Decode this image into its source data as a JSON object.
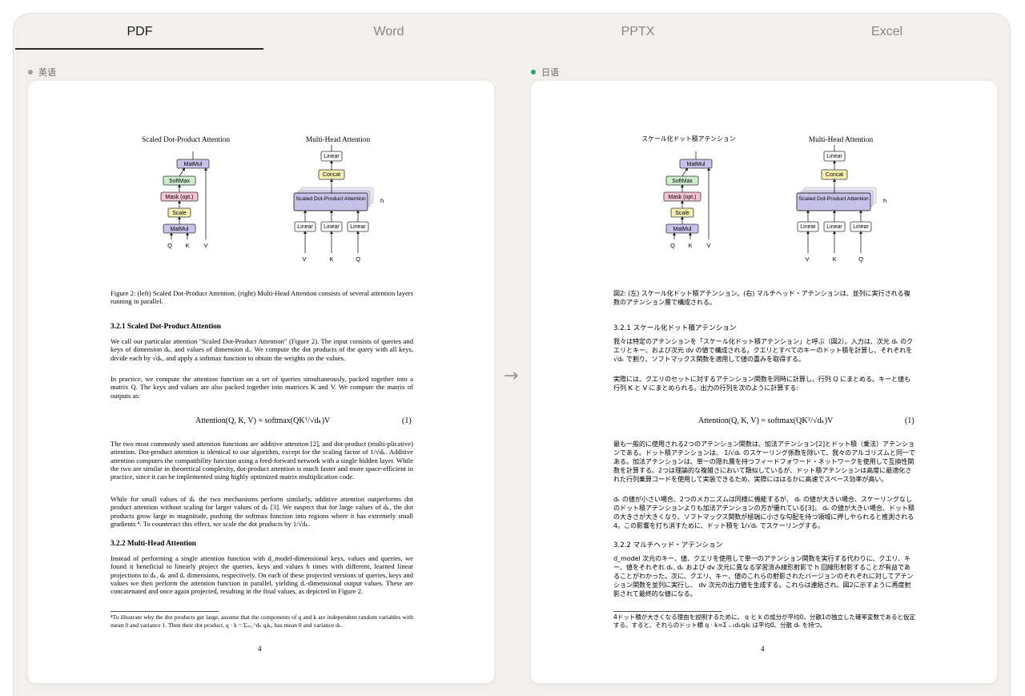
{
  "tabs": [
    {
      "label": "PDF",
      "active": true
    },
    {
      "label": "Word",
      "active": false
    },
    {
      "label": "PPTX",
      "active": false
    },
    {
      "label": "Excel",
      "active": false
    }
  ],
  "colors": {
    "accent": "#2a2a2a",
    "source_dot": "#a3a09b",
    "target_dot": "#2b9e83",
    "frame_bg": "#f2f0ec"
  },
  "source": {
    "label": "英语",
    "diagram": {
      "left_title": "Scaled Dot-Product Attention",
      "right_title": "Multi-Head Attention",
      "left_blocks": [
        "MatMul",
        "SoftMax",
        "Mask (opt.)",
        "Scale",
        "MatMul"
      ],
      "left_inputs": [
        "Q",
        "K",
        "V"
      ],
      "right_blocks": [
        "Linear",
        "Concat",
        "Scaled Dot-Product Attention",
        "Linear",
        "Linear",
        "Linear"
      ],
      "right_inputs": [
        "V",
        "K",
        "Q"
      ],
      "h_label": "h"
    },
    "caption": "Figure 2: (left) Scaled Dot-Product Attention. (right) Multi-Head Attention consists of several attention layers running in parallel.",
    "sec1_title": "3.2.1    Scaled Dot-Product Attention",
    "p1": "We call our particular attention \"Scaled Dot-Product Attention\" (Figure 2). The input consists of queries and keys of dimension dₖ, and values of dimension dᵥ. We compute the dot products of the query with all keys, divide each by √dₖ, and apply a softmax function to obtain the weights on the values.",
    "p2": "In practice, we compute the attention function on a set of queries simultaneously, packed together into a matrix Q. The keys and values are also packed together into matrices K and V. We compute the matrix of outputs as:",
    "equation": "Attention(Q, K, V) = softmax(QKᵀ/√dₖ)V",
    "equation_number": "(1)",
    "p3": "The two most commonly used attention functions are additive attention [2], and dot-product (multi-plicative) attention. Dot-product attention is identical to our algorithm, except for the scaling factor of 1/√dₖ. Additive attention computes the compatibility function using a feed-forward network with a single hidden layer. While the two are similar in theoretical complexity, dot-product attention is much faster and more space-efficient in practice, since it can be implemented using highly optimized matrix multiplication code.",
    "p4": "While for small values of dₖ the two mechanisms perform similarly, additive attention outperforms dot product attention without scaling for larger values of dₖ [3]. We suspect that for large values of dₖ, the dot products grow large in magnitude, pushing the softmax function into regions where it has extremely small gradients ⁴. To counteract this effect, we scale the dot products by 1/√dₖ.",
    "sec2_title": "3.2.2    Multi-Head Attention",
    "p5": "Instead of performing a single attention function with d_model-dimensional keys, values and queries, we found it beneficial to linearly project the queries, keys and values h times with different, learned linear projections to dₖ, dₖ and dᵥ dimensions, respectively. On each of these projected versions of queries, keys and values we then perform the attention function in parallel, yielding dᵥ-dimensional output values. These are concatenated and once again projected, resulting in the final values, as depicted in Figure 2.",
    "footnote": "⁴To illustrate why the dot products get large, assume that the components of q and k are independent random variables with mean 0 and variance 1. Then their dot product, q · k = Σᵢ₌₁^dₖ qᵢkᵢ, has mean 0 and variance dₖ.",
    "page_number": "4"
  },
  "arrow": "→",
  "target": {
    "label": "日语",
    "diagram": {
      "left_title": "スケール化ドット積アテンション",
      "right_title": "Multi-Head Attention",
      "left_blocks": [
        "MatMul",
        "SoftMax",
        "Mask (opt.)",
        "Scale",
        "MatMul"
      ],
      "left_inputs": [
        "Q",
        "K",
        "V"
      ],
      "right_blocks": [
        "Linear",
        "Concat",
        "Scaled Dot-Product Attention",
        "Linear",
        "Linear",
        "Linear"
      ],
      "right_inputs": [
        "V",
        "K",
        "Q"
      ],
      "h_label": "h"
    },
    "caption": "図2: (左) スケール化ドット積アテンション。(右) マルチヘッド・アテンションは、並列に実行される複数のアテンション層で構成される。",
    "sec1_title": "3.2.1 スケール化ドット積アテンション",
    "p1": "我々は特定のアテンションを「スケール化ドット積アテンション」と呼ぶ（図2）。入力は、次元 dₖ のクエリとキー、および次元 dv の値で構成される。クエリとすべてのキーのドット積を計算し、それぞれを √dₖ で割り、ソフトマックス関数を適用して値の重みを取得する。",
    "p2": "実際には、クエリのセットに対するアテンション関数を同時に計算し、行列 Q にまとめる。キーと値も行列 K と V にまとめられる。出力の行列を次のように計算する:",
    "equation": "Attention(Q, K, V) = softmax(QKᵀ/√dₖ)V",
    "equation_number": "(1)",
    "p3": "最も一般的に使用される2つのアテンション関数は、加法アテンション[2]とドット積（乗法）アテンションである。ドット積アテンションは、 1/√dₖ のスケーリング係数を除いて、我々のアルゴリズムと同一である。加法アテンションは、単一の隠れ層を持つフィードフォワード・ネットワークを使用して互換性関数を計算する。2つは理論的な複雑さにおいて類似しているが、ドット積アテンションは高度に最適化された行列乗算コードを使用して実装できるため、実際にははるかに高速でスペース効率が高い。",
    "p4": "dₖ の値が小さい場合、2つのメカニズムは同様に機能するが、 dₖ の値が大きい場合、スケーリングなしのドット積アテンションよりも加法アテンションの方が優れている[3]。 dₖ の値が大きい場合、ドット積の大きさが大きくなり、ソフトマックス関数が極端に小さな勾配を持つ領域に押しやられると推測される4。この影響を打ち消すために、ドット積を 1/√dₖ でスケーリングする。",
    "sec2_title": "3.2.2 マルチヘッド・アテンション",
    "p5": "d_model 次元のキー、値、クエリを使用して単一のアテンション関数を実行する代わりに、クエリ、キー、値をそれぞれ dₖ, dₖ および dv 次元に異なる学習済み線形射影で h 回線形射影することが有益であることがわかった。次に、クエリ、キー、値のこれらの射影されたバージョンのそれぞれに対してアテンション関数を並列に実行し、 dv 次元の出力値を生成する。これらは連結され、図2に示すように再度射影されて最終的な値になる。",
    "footnote": "4ドット積が大きくなる理由を説明するために、 q と k の成分が平均0、分散1の独立した確率変数であると仮定する。すると、それらのドット積 q · k=Σ ᵢ₌₁dₖqᵢkᵢ は平均0、分散 dₖ を持つ。",
    "page_number": "4"
  }
}
